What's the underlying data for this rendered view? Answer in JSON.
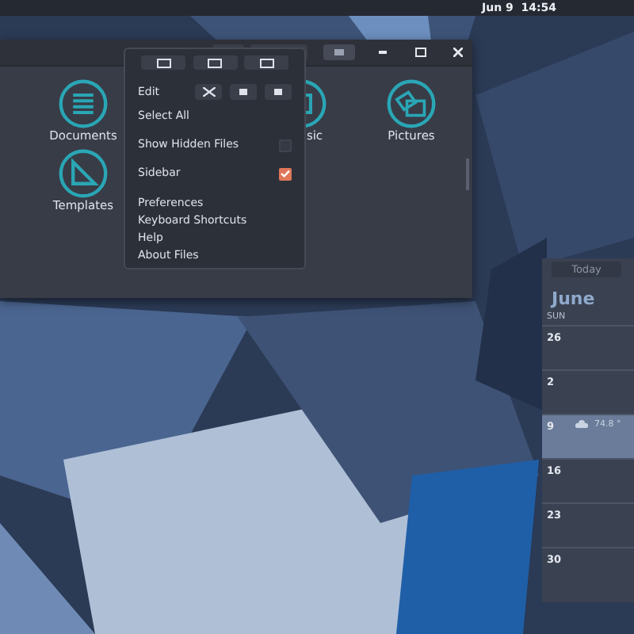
{
  "top_bar": {
    "clock": "Jun 9  14:54"
  },
  "files_window": {
    "items": [
      {
        "kind": "generic"
      },
      {
        "kind": "documents",
        "label": "Documents"
      },
      {
        "kind": "empty"
      },
      {
        "kind": "music",
        "label": "sic"
      },
      {
        "kind": "pictures",
        "label": "Pictures"
      },
      {
        "kind": "generic"
      },
      {
        "kind": "templates",
        "label": "Templates"
      }
    ]
  },
  "menu": {
    "edit_label": "Edit",
    "items": [
      {
        "kind": "plain",
        "label": "Select All"
      },
      {
        "kind": "toggle",
        "label": "Show Hidden Files",
        "checked": false
      },
      {
        "kind": "toggle",
        "label": "Sidebar",
        "checked": true
      },
      {
        "kind": "group",
        "label": "Preferences"
      },
      {
        "kind": "plain",
        "label": "Keyboard Shortcuts"
      },
      {
        "kind": "plain",
        "label": "Help"
      },
      {
        "kind": "plain",
        "label": "About Files"
      }
    ]
  },
  "calendar": {
    "today_button": "Today",
    "month": "June",
    "weekday": "SUN",
    "days": [
      {
        "day": "26",
        "selected": false
      },
      {
        "day": "2",
        "selected": false
      },
      {
        "day": "9",
        "selected": true,
        "weather": "74.8 °"
      },
      {
        "day": "16",
        "selected": false
      },
      {
        "day": "23",
        "selected": false
      },
      {
        "day": "30",
        "selected": false
      }
    ]
  }
}
